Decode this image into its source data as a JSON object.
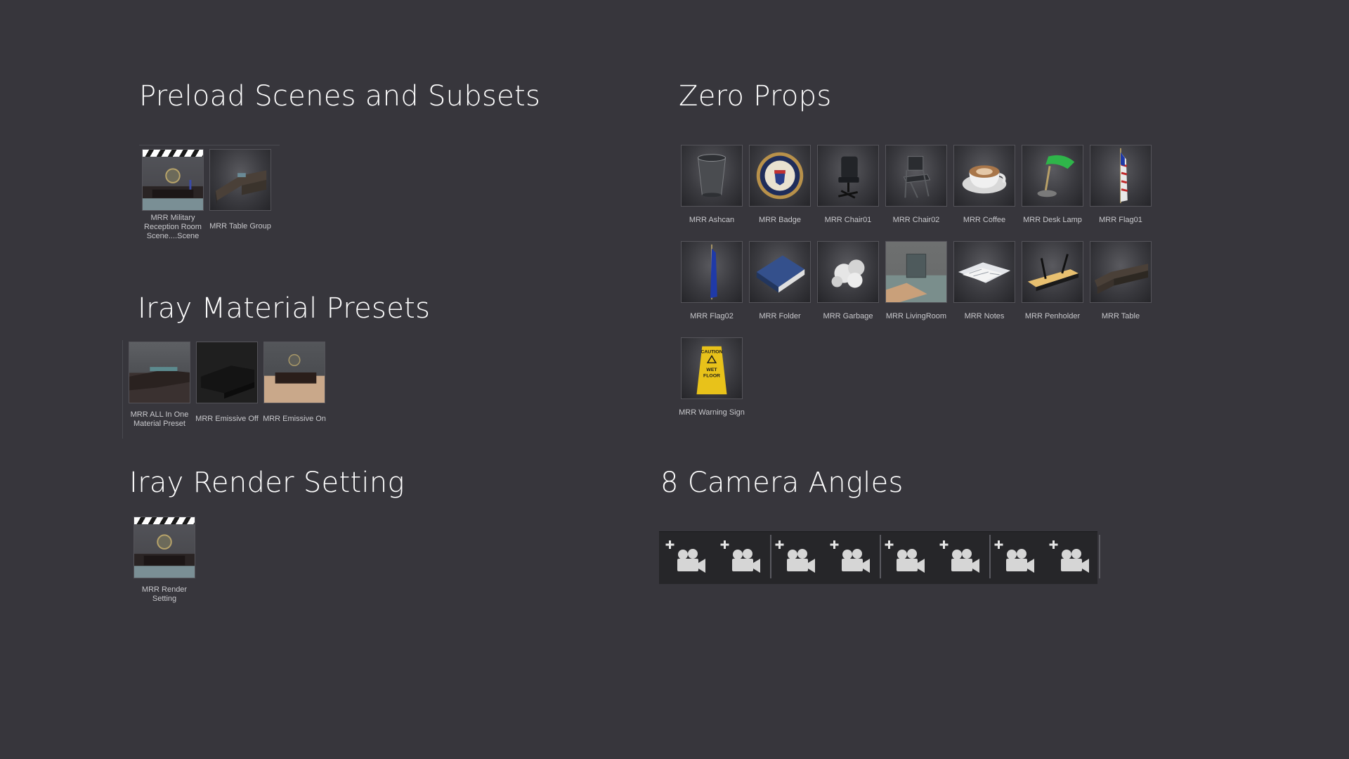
{
  "sections": {
    "preload": {
      "title": "Preload Scenes and Subsets",
      "items": [
        {
          "label": "MRR Military Reception Room Scene....Scene",
          "icon": "scene-icon"
        },
        {
          "label": "MRR Table Group",
          "icon": "table-group-icon"
        }
      ]
    },
    "material": {
      "title": "Iray Material Presets",
      "items": [
        {
          "label": "MRR ALL In One Material Preset",
          "icon": "material-preset-icon"
        },
        {
          "label": "MRR Emissive Off",
          "icon": "emissive-off-icon"
        },
        {
          "label": "MRR Emissive On",
          "icon": "emissive-on-icon"
        }
      ]
    },
    "render": {
      "title": "Iray Render Setting",
      "items": [
        {
          "label": "MRR Render Setting",
          "icon": "render-setting-icon"
        }
      ]
    },
    "props": {
      "title": "Zero Props",
      "items": [
        {
          "label": "MRR Ashcan",
          "icon": "ashcan-icon"
        },
        {
          "label": "MRR Badge",
          "icon": "badge-icon"
        },
        {
          "label": "MRR Chair01",
          "icon": "office-chair-icon"
        },
        {
          "label": "MRR Chair02",
          "icon": "folding-chair-icon"
        },
        {
          "label": "MRR Coffee",
          "icon": "coffee-cup-icon"
        },
        {
          "label": "MRR Desk Lamp",
          "icon": "desk-lamp-icon"
        },
        {
          "label": "MRR Flag01",
          "icon": "us-flag-icon"
        },
        {
          "label": "MRR Flag02",
          "icon": "blue-flag-icon"
        },
        {
          "label": "MRR Folder",
          "icon": "folder-icon"
        },
        {
          "label": "MRR Garbage",
          "icon": "garbage-icon"
        },
        {
          "label": "MRR LivingRoom",
          "icon": "living-room-icon"
        },
        {
          "label": "MRR Notes",
          "icon": "notes-icon"
        },
        {
          "label": "MRR Penholder",
          "icon": "penholder-icon"
        },
        {
          "label": "MRR Table",
          "icon": "table-icon"
        },
        {
          "label": "MRR Warning Sign",
          "icon": "warning-sign-icon"
        }
      ]
    },
    "cameras": {
      "title": "8 Camera Angles",
      "count": 8,
      "icon": "add-camera-icon"
    }
  },
  "colors": {
    "background": "#37363c",
    "title": "#ffffff",
    "caption": "#c8c8cc",
    "strip": "#262629",
    "flag_blue": "#1f3aa8",
    "lamp_green": "#2fb54a",
    "sign_yellow": "#e8c21a"
  },
  "warning_sign_text": [
    "CAUTION",
    "WET",
    "FLOOR"
  ]
}
